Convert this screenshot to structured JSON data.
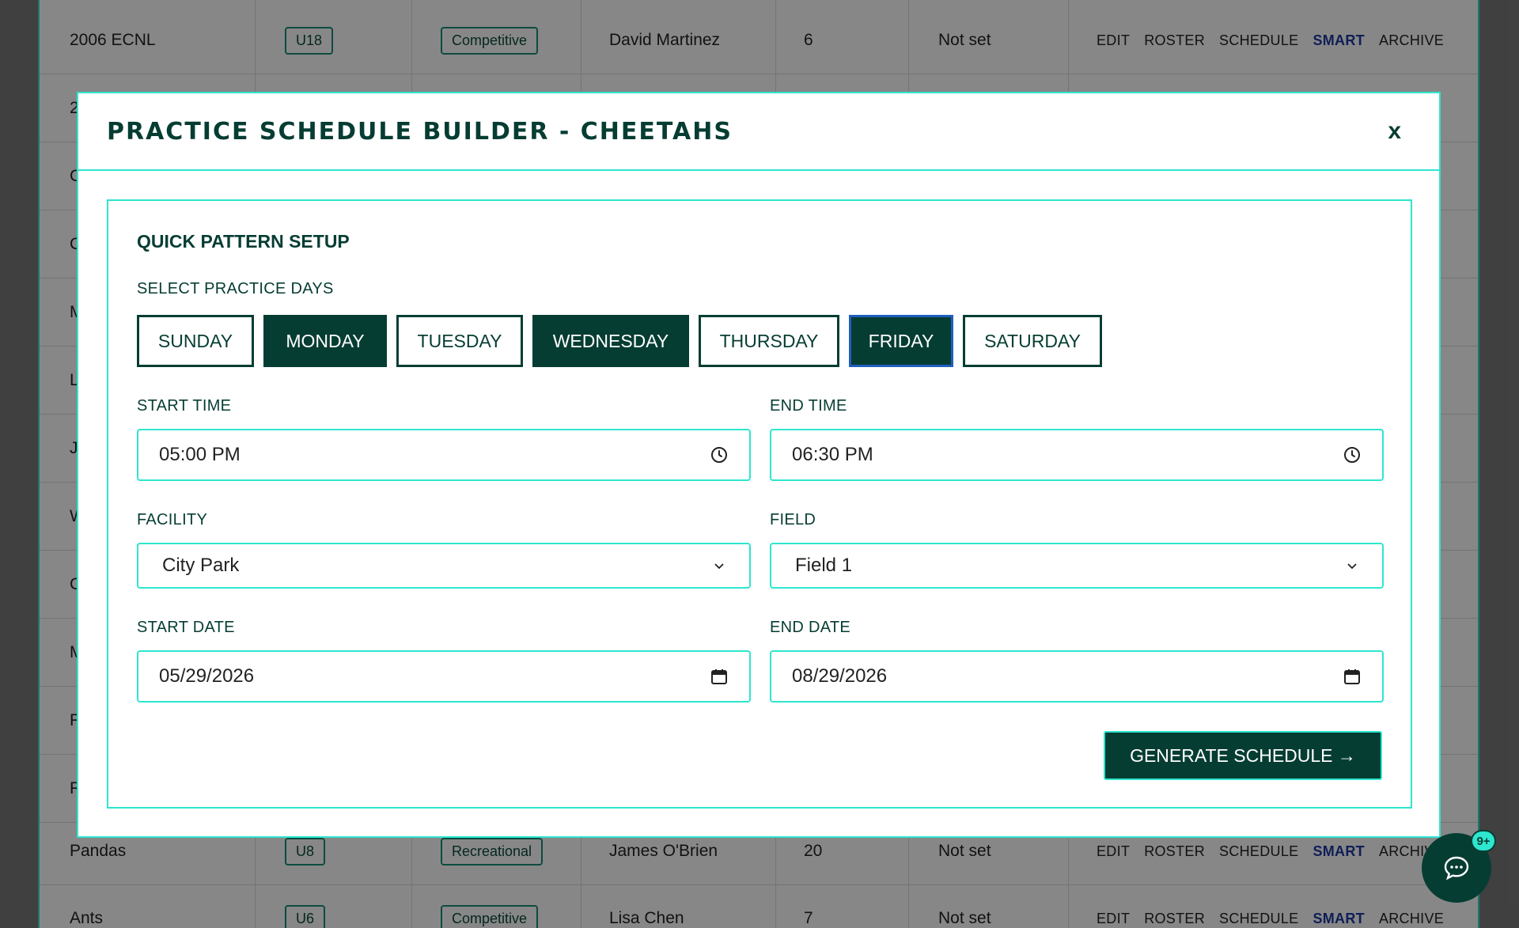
{
  "background": {
    "rows": [
      {
        "name": "2006 ECNL",
        "age": "U18",
        "type": "Competitive",
        "coach": "David Martinez",
        "players": "6",
        "status": "Not set"
      },
      {
        "name": "Pandas",
        "age": "U8",
        "type": "Recreational",
        "coach": "James O'Brien",
        "players": "20",
        "status": "Not set"
      },
      {
        "name": "Ants",
        "age": "U6",
        "type": "Competitive",
        "coach": "Lisa Chen",
        "players": "7",
        "status": "Not set"
      }
    ],
    "partial_initials": [
      "2",
      "C",
      "C",
      "M",
      "L",
      "J",
      "W",
      "C",
      "M",
      "F",
      "R"
    ],
    "actions": {
      "edit": "EDIT",
      "roster": "ROSTER",
      "schedule": "SCHEDULE",
      "smart": "SMART",
      "archive": "ARCHIVE",
      "archive_cut": "ARCHIV"
    }
  },
  "modal": {
    "title": "PRACTICE SCHEDULE BUILDER - CHEETAHS",
    "close_label": "x",
    "section_title": "QUICK PATTERN SETUP",
    "days_label": "SELECT PRACTICE DAYS",
    "days": [
      {
        "label": "SUNDAY",
        "selected": false
      },
      {
        "label": "MONDAY",
        "selected": true
      },
      {
        "label": "TUESDAY",
        "selected": false
      },
      {
        "label": "WEDNESDAY",
        "selected": true
      },
      {
        "label": "THURSDAY",
        "selected": false
      },
      {
        "label": "FRIDAY",
        "selected": true
      },
      {
        "label": "SATURDAY",
        "selected": false
      }
    ],
    "start_time": {
      "label": "START TIME",
      "value": "05:00 PM"
    },
    "end_time": {
      "label": "END TIME",
      "value": "06:30 PM"
    },
    "facility": {
      "label": "FACILITY",
      "value": "City Park"
    },
    "field": {
      "label": "FIELD",
      "value": "Field 1"
    },
    "start_date": {
      "label": "START DATE",
      "value": "05/29/2026"
    },
    "end_date": {
      "label": "END DATE",
      "value": "08/29/2026"
    },
    "generate_label": "GENERATE SCHEDULE →"
  },
  "chat": {
    "badge": "9+"
  },
  "colors": {
    "primary": "#063d33",
    "accent": "#2ee6cf",
    "smart_link": "#1f3aa5"
  }
}
